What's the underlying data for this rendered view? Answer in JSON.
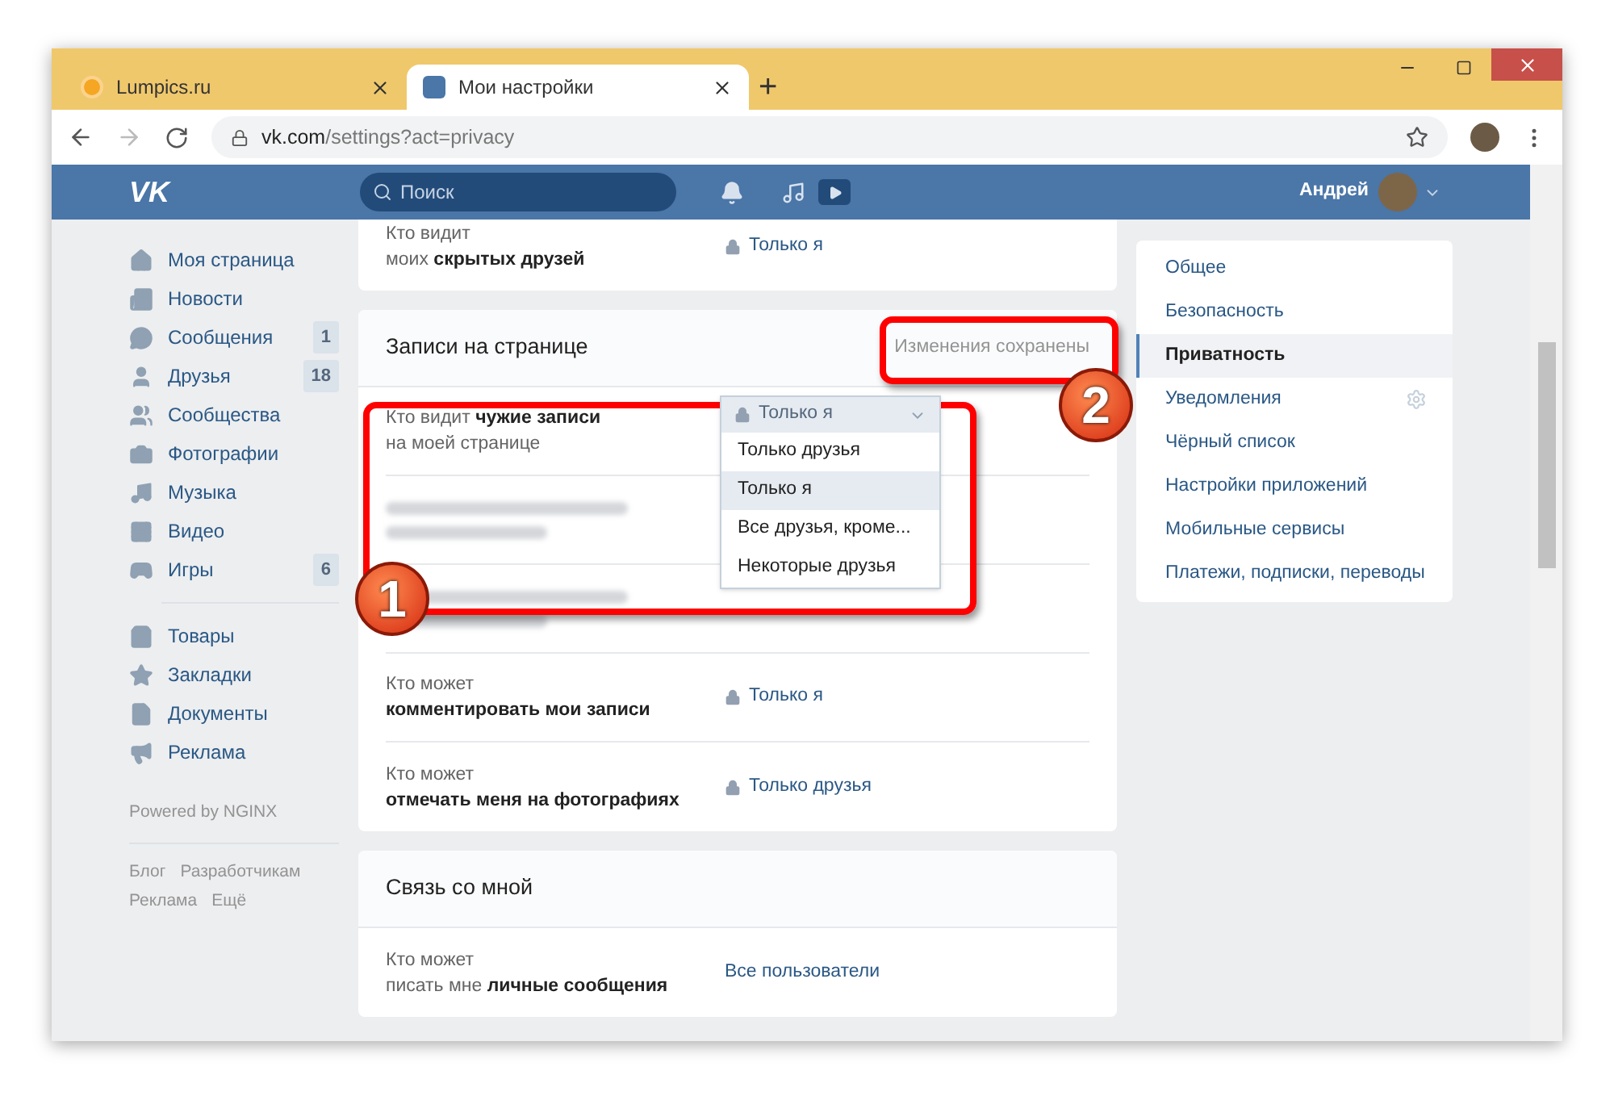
{
  "browser": {
    "tabs": [
      {
        "title": "Lumpics.ru",
        "selected": false
      },
      {
        "title": "Мои настройки",
        "selected": true
      }
    ],
    "new_tab": "+",
    "url_host": "vk.com",
    "url_path": "/settings?act=privacy"
  },
  "header": {
    "logo": "VK",
    "search_placeholder": "Поиск",
    "user_name": "Андрей"
  },
  "left_nav": {
    "items": [
      {
        "label": "Моя страница"
      },
      {
        "label": "Новости"
      },
      {
        "label": "Сообщения",
        "count": "1"
      },
      {
        "label": "Друзья",
        "count": "18"
      },
      {
        "label": "Сообщества"
      },
      {
        "label": "Фотографии"
      },
      {
        "label": "Музыка"
      },
      {
        "label": "Видео"
      },
      {
        "label": "Игры",
        "count": "6"
      }
    ],
    "items_2": [
      {
        "label": "Товары"
      },
      {
        "label": "Закладки"
      },
      {
        "label": "Документы"
      },
      {
        "label": "Реклама"
      }
    ],
    "powered": "Powered by NGINX",
    "footer_links": [
      "Блог",
      "Разработчикам",
      "Реклама",
      "Ещё"
    ]
  },
  "sections": [
    {
      "rows": [
        {
          "label_lines": [
            "Кто видит",
            "моих **скрытых друзей**"
          ],
          "value": "Только я",
          "locked": true
        }
      ]
    },
    {
      "title": "Записи на странице",
      "status": "Изменения сохранены",
      "rows": [
        {
          "label_lines": [
            "Кто видит **чужие записи**",
            "на моей странице"
          ],
          "kind": "dropdown",
          "value": "Только я",
          "locked": true,
          "options": [
            {
              "label": "Только друзья",
              "selected": false
            },
            {
              "label": "Только я",
              "selected": true
            },
            {
              "label": "Все друзья, кроме...",
              "selected": false
            },
            {
              "label": "Некоторые друзья",
              "selected": false
            }
          ]
        },
        {
          "kind": "blurred"
        },
        {
          "kind": "blurred"
        },
        {
          "label_lines": [
            "Кто может",
            "**комментировать мои записи**"
          ],
          "value": "Только я",
          "locked": true
        },
        {
          "label_lines": [
            "Кто может",
            "**отмечать меня на фотографиях**"
          ],
          "value": "Только друзья",
          "locked": true
        }
      ]
    },
    {
      "title": "Связь со мной",
      "rows": [
        {
          "label_lines": [
            "Кто может",
            "писать мне **личные сообщения**"
          ],
          "value": "Все пользователи",
          "locked": false
        }
      ]
    }
  ],
  "settings_menu": [
    {
      "label": "Общее",
      "selected": false
    },
    {
      "label": "Безопасность",
      "selected": false
    },
    {
      "label": "Приватность",
      "selected": true
    },
    {
      "label": "Уведомления",
      "selected": false,
      "gear": true
    },
    {
      "label": "Чёрный список",
      "selected": false
    },
    {
      "label": "Настройки приложений",
      "selected": false
    },
    {
      "label": "Мобильные сервисы",
      "selected": false
    },
    {
      "label": "Платежи, подписки, переводы",
      "selected": false
    }
  ],
  "annotations": [
    "1",
    "2"
  ]
}
